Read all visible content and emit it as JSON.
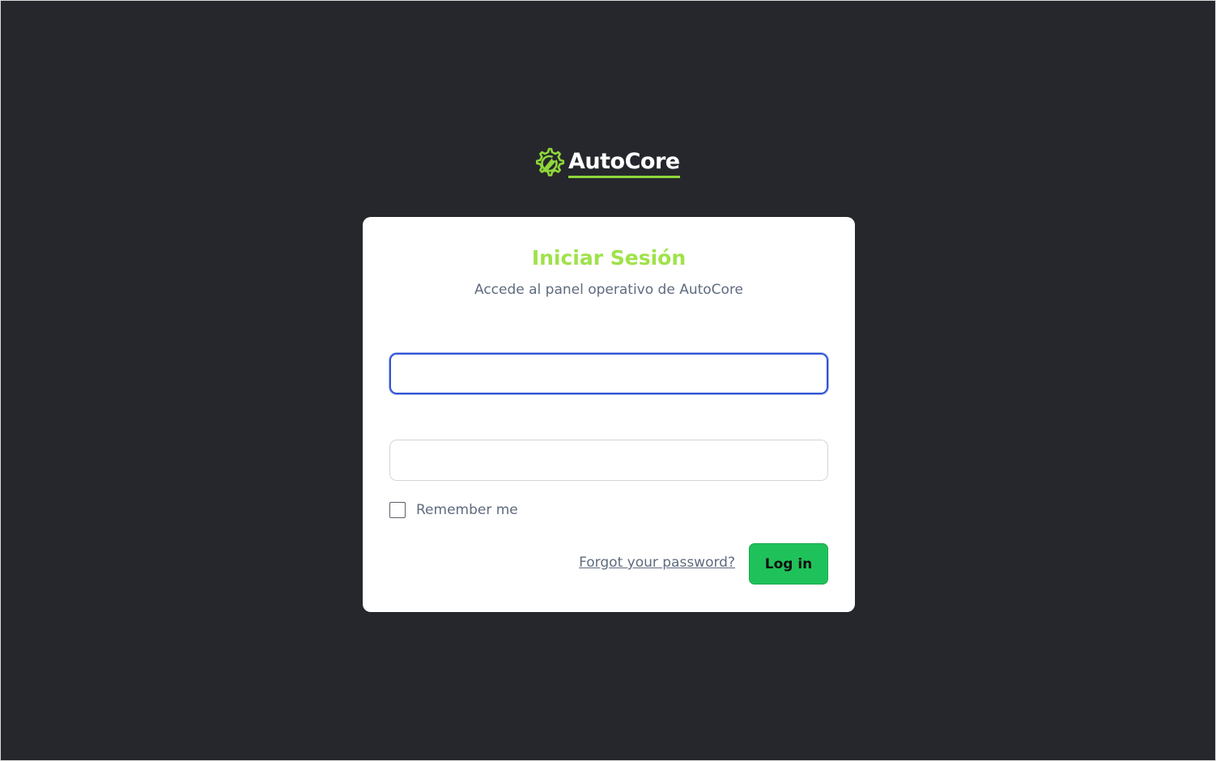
{
  "brand": {
    "name": "AutoCore",
    "icon": "gear-wrench-icon",
    "accent_color": "#8fd63a"
  },
  "login": {
    "title": "Iniciar Sesión",
    "subtitle": "Accede al panel operativo de AutoCore",
    "email": {
      "value": "",
      "placeholder": ""
    },
    "password": {
      "value": "",
      "placeholder": ""
    },
    "remember_label": "Remember me",
    "remember_checked": false,
    "forgot_label": "Forgot your password?",
    "submit_label": "Log in",
    "title_color": "#9fe24a",
    "button_color": "#1fc25a",
    "focus_color": "#3155d4"
  },
  "page": {
    "background_color": "#26272c"
  }
}
